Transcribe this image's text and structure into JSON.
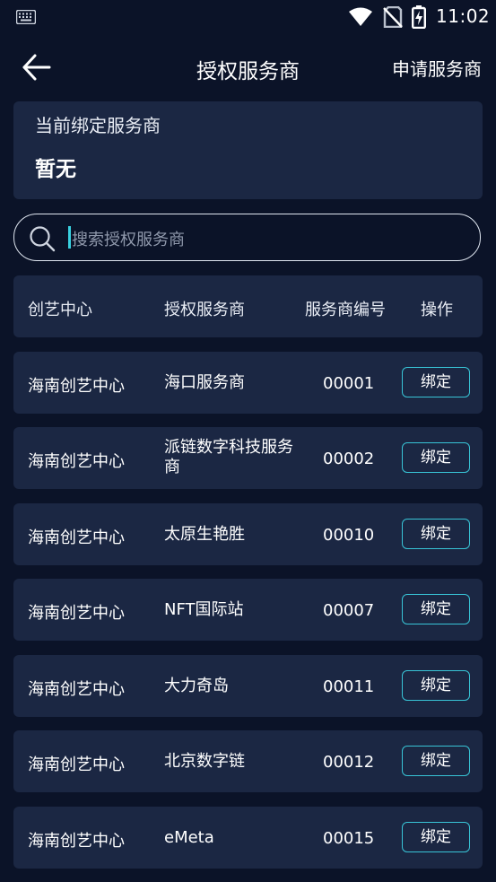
{
  "status_bar": {
    "time": "11:02"
  },
  "header": {
    "title": "授权服务商",
    "apply_label": "申请服务商"
  },
  "current": {
    "label": "当前绑定服务商",
    "value": "暂无"
  },
  "search": {
    "placeholder": "搜索授权服务商"
  },
  "table": {
    "columns": [
      "创艺中心",
      "授权服务商",
      "服务商编号",
      "操作"
    ],
    "rows": [
      {
        "center": "海南创艺中心",
        "name": "海口服务商",
        "code": "00001",
        "action": "绑定"
      },
      {
        "center": "海南创艺中心",
        "name": "派链数字科技服务商",
        "code": "00002",
        "action": "绑定"
      },
      {
        "center": "海南创艺中心",
        "name": "太原生艳胜",
        "code": "00010",
        "action": "绑定"
      },
      {
        "center": "海南创艺中心",
        "name": "NFT国际站",
        "code": "00007",
        "action": "绑定"
      },
      {
        "center": "海南创艺中心",
        "name": "大力奇岛",
        "code": "00011",
        "action": "绑定"
      },
      {
        "center": "海南创艺中心",
        "name": "北京数字链",
        "code": "00012",
        "action": "绑定"
      },
      {
        "center": "海南创艺中心",
        "name": "eMeta",
        "code": "00015",
        "action": "绑定"
      }
    ]
  },
  "icons": {
    "status": [
      "keyboard-icon",
      "wifi-icon",
      "no-sim-icon",
      "battery-charging-icon"
    ],
    "nav": [
      "back-arrow-icon"
    ],
    "search": [
      "search-icon"
    ]
  },
  "colors": {
    "background": "#0b1328",
    "card": "#1b2743",
    "accent": "#38c4d6",
    "placeholder": "#8f98ab"
  }
}
